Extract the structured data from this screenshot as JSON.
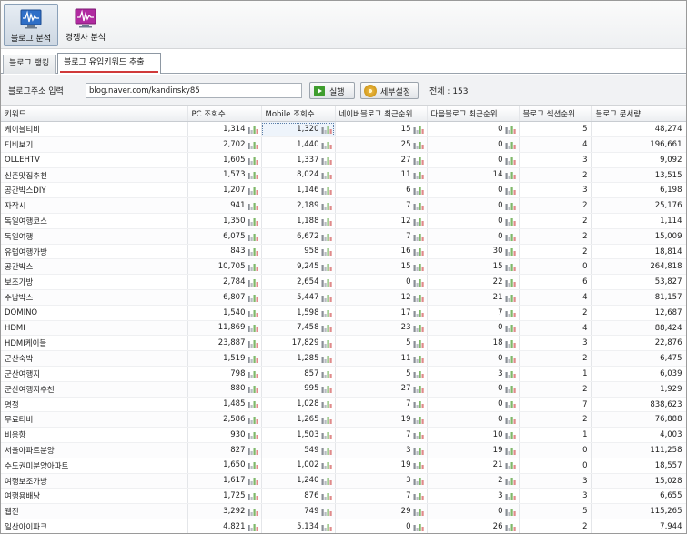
{
  "toolbar": {
    "blog_analysis_label": "블로그 분석",
    "competitor_analysis_label": "경쟁사 분석"
  },
  "tabs": {
    "ranking_label": "블로그 랭킹",
    "keyword_label": "블로그 유입키워드 추출"
  },
  "input_bar": {
    "label": "블로그주소 입력",
    "url_value": "blog.naver.com/kandinsky85",
    "run_label": "실행",
    "settings_label": "세부설정",
    "total_text": "전체 : 153"
  },
  "table": {
    "headers": [
      "키워드",
      "PC 조회수",
      "Mobile 조회수",
      "네이버블로그 최근순위",
      "다음블로그 최근순위",
      "블로그 섹션순위",
      "블로그 문서량"
    ],
    "rows": [
      [
        "케이블티비",
        "1,314",
        "1,320",
        "15",
        "0",
        "5",
        "48,274"
      ],
      [
        "티비보기",
        "2,702",
        "1,440",
        "25",
        "0",
        "4",
        "196,661"
      ],
      [
        "OLLEHTV",
        "1,605",
        "1,337",
        "27",
        "0",
        "3",
        "9,092"
      ],
      [
        "신촌맛집추천",
        "1,573",
        "8,024",
        "11",
        "14",
        "2",
        "13,515"
      ],
      [
        "공간박스DIY",
        "1,207",
        "1,146",
        "6",
        "0",
        "3",
        "6,198"
      ],
      [
        "자작시",
        "941",
        "2,189",
        "7",
        "0",
        "2",
        "25,176"
      ],
      [
        "독일여행코스",
        "1,350",
        "1,188",
        "12",
        "0",
        "2",
        "1,114"
      ],
      [
        "독일여행",
        "6,075",
        "6,672",
        "7",
        "0",
        "2",
        "15,009"
      ],
      [
        "유럽여행가방",
        "843",
        "958",
        "16",
        "30",
        "2",
        "18,814"
      ],
      [
        "공간박스",
        "10,705",
        "9,245",
        "15",
        "15",
        "0",
        "264,818"
      ],
      [
        "보조가방",
        "2,784",
        "2,654",
        "0",
        "22",
        "6",
        "53,827"
      ],
      [
        "수납박스",
        "6,807",
        "5,447",
        "12",
        "21",
        "4",
        "81,157"
      ],
      [
        "DOMINO",
        "1,540",
        "1,598",
        "17",
        "7",
        "2",
        "12,687"
      ],
      [
        "HDMI",
        "11,869",
        "7,458",
        "23",
        "0",
        "4",
        "88,424"
      ],
      [
        "HDMI케이블",
        "23,887",
        "17,829",
        "5",
        "18",
        "3",
        "22,876"
      ],
      [
        "군산숙박",
        "1,519",
        "1,285",
        "11",
        "0",
        "2",
        "6,475"
      ],
      [
        "군산여행지",
        "798",
        "857",
        "5",
        "3",
        "1",
        "6,039"
      ],
      [
        "군산여행지추천",
        "880",
        "995",
        "27",
        "0",
        "2",
        "1,929"
      ],
      [
        "명절",
        "1,485",
        "1,028",
        "7",
        "0",
        "7",
        "838,623"
      ],
      [
        "무료티비",
        "2,586",
        "1,265",
        "19",
        "0",
        "2",
        "76,888"
      ],
      [
        "비응항",
        "930",
        "1,503",
        "7",
        "10",
        "1",
        "4,003"
      ],
      [
        "서울아파트분양",
        "827",
        "549",
        "3",
        "19",
        "0",
        "111,258"
      ],
      [
        "수도권미분양아파트",
        "1,650",
        "1,002",
        "19",
        "21",
        "0",
        "18,557"
      ],
      [
        "여행보조가방",
        "1,617",
        "1,240",
        "3",
        "2",
        "3",
        "15,028"
      ],
      [
        "여행용배낭",
        "1,725",
        "876",
        "7",
        "3",
        "3",
        "6,655"
      ],
      [
        "웹진",
        "3,292",
        "749",
        "29",
        "0",
        "5",
        "115,265"
      ],
      [
        "일산아이파크",
        "4,821",
        "5,134",
        "0",
        "26",
        "2",
        "7,944"
      ]
    ]
  },
  "colors": {
    "blog_icon": "#2f6fc7",
    "competitor_icon": "#b02aa0",
    "tab_underline": "#d03a3a",
    "run_icon": "#3f9d2e"
  },
  "icons": {
    "blog_analysis": "waveform-monitor-icon",
    "competitor_analysis": "waveform-monitor-icon",
    "run": "play-icon",
    "settings": "gear-icon",
    "cell_chart": "mini-bar-chart-icon"
  }
}
